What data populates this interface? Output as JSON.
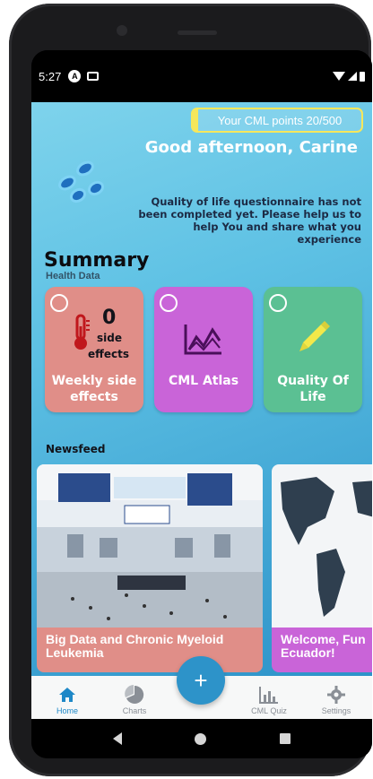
{
  "status_bar": {
    "time": "5:27"
  },
  "header": {
    "points_text": "Your CML points 20/500",
    "greeting": "Good afternoon, Carine",
    "notice": "Quality of life questionnaire has not been completed yet. Please help us to help You and share what you experience"
  },
  "summary": {
    "title": "Summary",
    "subtitle": "Health Data",
    "cards": [
      {
        "count": "0",
        "count_label_1": "side",
        "count_label_2": "effects",
        "label": "Weekly side effects",
        "color": "#e08e88",
        "icon": "thermometer-icon"
      },
      {
        "label": "CML Atlas",
        "color": "#c964d8",
        "icon": "line-chart-icon"
      },
      {
        "label": "Quality Of Life",
        "color": "#5bc093",
        "icon": "pencil-icon"
      }
    ]
  },
  "newsfeed": {
    "title": "Newsfeed",
    "items": [
      {
        "caption": "Big Data and Chronic Myeloid Leukemia",
        "color": "#e08e88"
      },
      {
        "caption": "Welcome, Fun Ecuador!",
        "color": "#c964d8"
      }
    ]
  },
  "bottom_nav": {
    "items": [
      {
        "label": "Home",
        "icon": "home-icon",
        "active": true
      },
      {
        "label": "Charts",
        "icon": "pie-chart-icon",
        "active": false
      },
      {
        "label": "CML Quiz",
        "icon": "bar-chart-icon",
        "active": false
      },
      {
        "label": "Settings",
        "icon": "gear-icon",
        "active": false
      }
    ],
    "fab_label": "+"
  },
  "colors": {
    "accent": "#2d93c9",
    "points_border": "#f6e75b"
  }
}
